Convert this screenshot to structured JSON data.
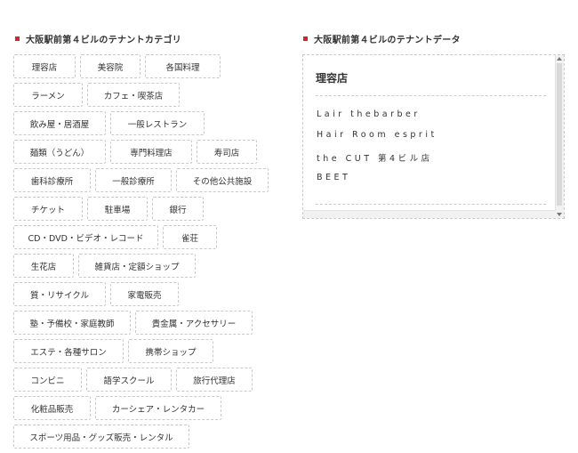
{
  "categories_section": {
    "title": "大阪駅前第４ビルのテナントカテゴリ",
    "rows": [
      [
        "理容店",
        "美容院",
        "各国料理"
      ],
      [
        "ラーメン",
        "カフェ・喫茶店"
      ],
      [
        "飲み屋・居酒屋",
        "一般レストラン"
      ],
      [
        "麺類（うどん）",
        "専門料理店",
        "寿司店"
      ],
      [
        "歯科診療所",
        "一般診療所",
        "その他公共施設"
      ],
      [
        "チケット",
        "駐車場",
        "銀行"
      ],
      [
        "CD・DVD・ビデオ・レコード",
        "雀荘"
      ],
      [
        "生花店",
        "雑貨店・定額ショップ"
      ],
      [
        "質・リサイクル",
        "家電販売"
      ],
      [
        "塾・予備校・家庭教師",
        "貴金属・アクセサリー"
      ],
      [
        "エステ・各種サロン",
        "携帯ショップ"
      ],
      [
        "コンビニ",
        "語学スクール",
        "旅行代理店"
      ],
      [
        "化粧品販売",
        "カーシェア・レンタカー"
      ],
      [
        "スポーツ用品・グッズ販売・レンタル"
      ]
    ]
  },
  "data_section": {
    "title": "大阪駅前第４ビルのテナントデータ",
    "selected_category": "理容店",
    "tenants": [
      "Lair thebarber",
      "Hair Room esprit",
      "the CUT 第4ビル店",
      "BEET"
    ]
  }
}
